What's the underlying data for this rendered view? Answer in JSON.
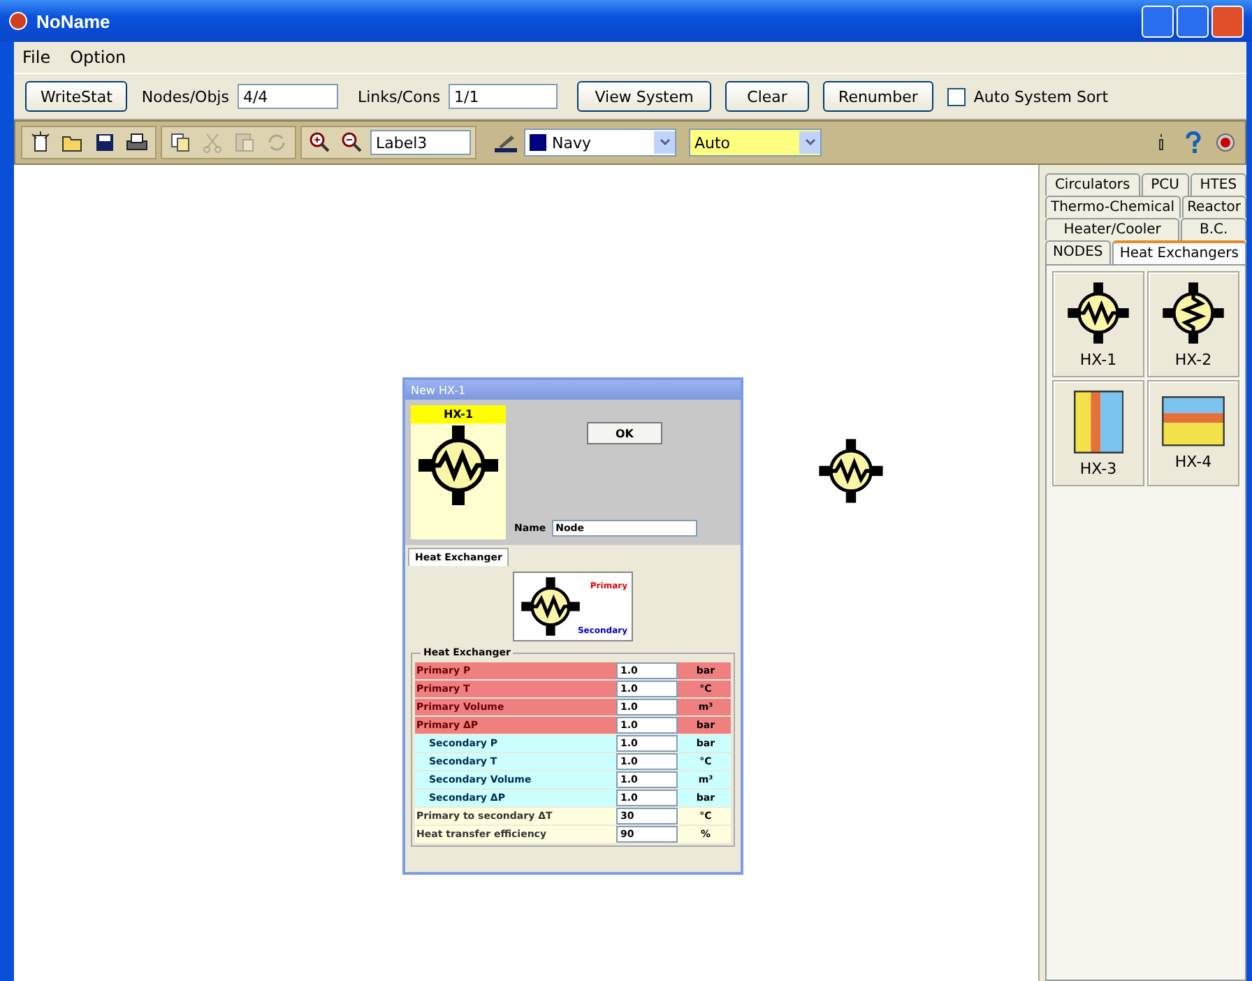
{
  "window": {
    "title": "NoName"
  },
  "menu": [
    "File",
    "Option"
  ],
  "toolbar": {
    "writestat": "WriteStat",
    "nodes_label": "Nodes/Objs",
    "nodes_value": "4/4",
    "links_label": "Links/Cons",
    "links_value": "1/1",
    "buttons": [
      "View System",
      "Clear",
      "Renumber"
    ],
    "auto_sort": {
      "label": "Auto System Sort",
      "checked": false
    }
  },
  "tools": [
    {
      "kind": "new",
      "disabled": false
    },
    {
      "kind": "open",
      "disabled": false
    },
    {
      "kind": "save",
      "disabled": false
    },
    {
      "kind": "print",
      "disabled": false
    },
    {
      "kind": "copy",
      "disabled": false
    },
    {
      "kind": "cut",
      "disabled": true
    },
    {
      "kind": "paste",
      "disabled": true
    },
    {
      "kind": "refresh",
      "disabled": true
    },
    {
      "kind": "zoomin",
      "disabled": false
    },
    {
      "kind": "zoomout",
      "disabled": false
    }
  ],
  "label_field": "Label3",
  "color_select": {
    "value": "Navy",
    "color": "#000080"
  },
  "mode_select": "Auto",
  "dialog": {
    "title": "New HX-1",
    "header": "HX-1",
    "ok": "OK",
    "name_label": "Name",
    "name_value": "Node",
    "tab": "Heat Exchanger",
    "primary_label": "Primary",
    "secondary_label": "Secondary",
    "group": "Heat Exchanger",
    "rows": [
      {
        "kind": "primary",
        "label": "Primary P",
        "value": "1.0",
        "unit": "bar"
      },
      {
        "kind": "primary",
        "label": "Primary T",
        "value": "1.0",
        "unit": "°C"
      },
      {
        "kind": "primary",
        "label": "Primary Volume",
        "value": "1.0",
        "unit": "m³"
      },
      {
        "kind": "primary",
        "label": "Primary ΔP",
        "value": "1.0",
        "unit": "bar"
      },
      {
        "kind": "secondary",
        "label": "Secondary P",
        "value": "1.0",
        "unit": "bar"
      },
      {
        "kind": "secondary",
        "label": "Secondary T",
        "value": "1.0",
        "unit": "°C"
      },
      {
        "kind": "secondary",
        "label": "Secondary Volume",
        "value": "1.0",
        "unit": "m³"
      },
      {
        "kind": "secondary",
        "label": "Secondary ΔP",
        "value": "1.0",
        "unit": "bar"
      },
      {
        "kind": "other",
        "label": "Primary to secondary ΔT",
        "value": "30",
        "unit": "°C"
      },
      {
        "kind": "other",
        "label": "Heat transfer efficiency",
        "value": "90",
        "unit": "%"
      }
    ]
  },
  "palette": {
    "tab_rows": [
      [
        {
          "label": "Circulators",
          "selected": false
        },
        {
          "label": "PCU",
          "selected": false
        },
        {
          "label": "HTES",
          "selected": false
        }
      ],
      [
        {
          "label": "Thermo-Chemical",
          "selected": false
        },
        {
          "label": "Reactor",
          "selected": false
        }
      ],
      [
        {
          "label": "Heater/Cooler",
          "selected": false
        },
        {
          "label": "B.C.",
          "selected": false
        }
      ],
      [
        {
          "label": "NODES",
          "selected": false
        },
        {
          "label": "Heat Exchangers",
          "selected": true
        }
      ]
    ],
    "items": [
      {
        "kind": "hx1",
        "label": "HX-1"
      },
      {
        "kind": "hx2",
        "label": "HX-2"
      },
      {
        "kind": "hx3",
        "label": "HX-3"
      },
      {
        "kind": "hx4",
        "label": "HX-4"
      }
    ]
  }
}
